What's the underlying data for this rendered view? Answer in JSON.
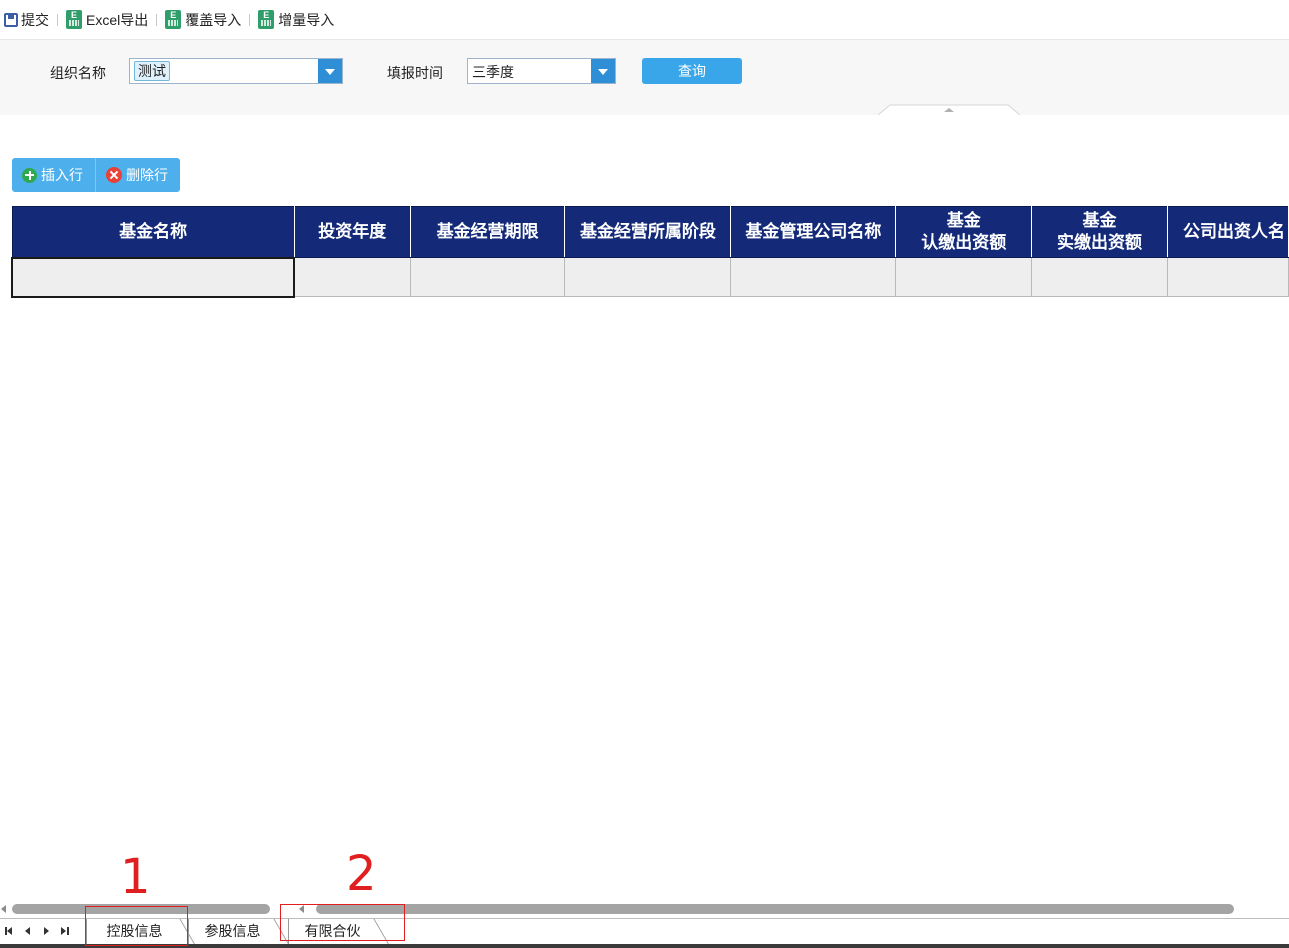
{
  "toolbar": {
    "submit_label": "提交",
    "excel_export_label": "Excel导出",
    "overwrite_import_label": "覆盖导入",
    "incremental_import_label": "增量导入",
    "excel_icon_letter": "E"
  },
  "filter": {
    "org_label": "组织名称",
    "org_value": "测试",
    "period_label": "填报时间",
    "period_value": "三季度",
    "query_label": "查询"
  },
  "row_actions": {
    "insert_label": "插入行",
    "delete_label": "删除行"
  },
  "grid": {
    "columns": [
      {
        "line1": "基金名称",
        "line2": ""
      },
      {
        "line1": "投资年度",
        "line2": ""
      },
      {
        "line1": "基金经营期限",
        "line2": ""
      },
      {
        "line1": "基金经营所属阶段",
        "line2": ""
      },
      {
        "line1": "基金管理公司名称",
        "line2": ""
      },
      {
        "line1": "基金",
        "line2": "认缴出资额"
      },
      {
        "line1": "基金",
        "line2": "实缴出资额"
      },
      {
        "line1": "公司出资人名",
        "line2": ""
      }
    ],
    "rows": [
      [
        "",
        "",
        "",
        "",
        "",
        "",
        "",
        ""
      ]
    ]
  },
  "sheets": {
    "tabs": [
      {
        "label": "控股信息",
        "active": true
      },
      {
        "label": "参股信息",
        "active": false
      },
      {
        "label": "有限合伙",
        "active": false
      }
    ]
  },
  "annotations": {
    "marker_1": "1",
    "marker_2": "2"
  },
  "colors": {
    "header_bg": "#142a78",
    "button_bg": "#4db0ec",
    "query_bg": "#3aa6ea",
    "annotation": "#e02020"
  }
}
